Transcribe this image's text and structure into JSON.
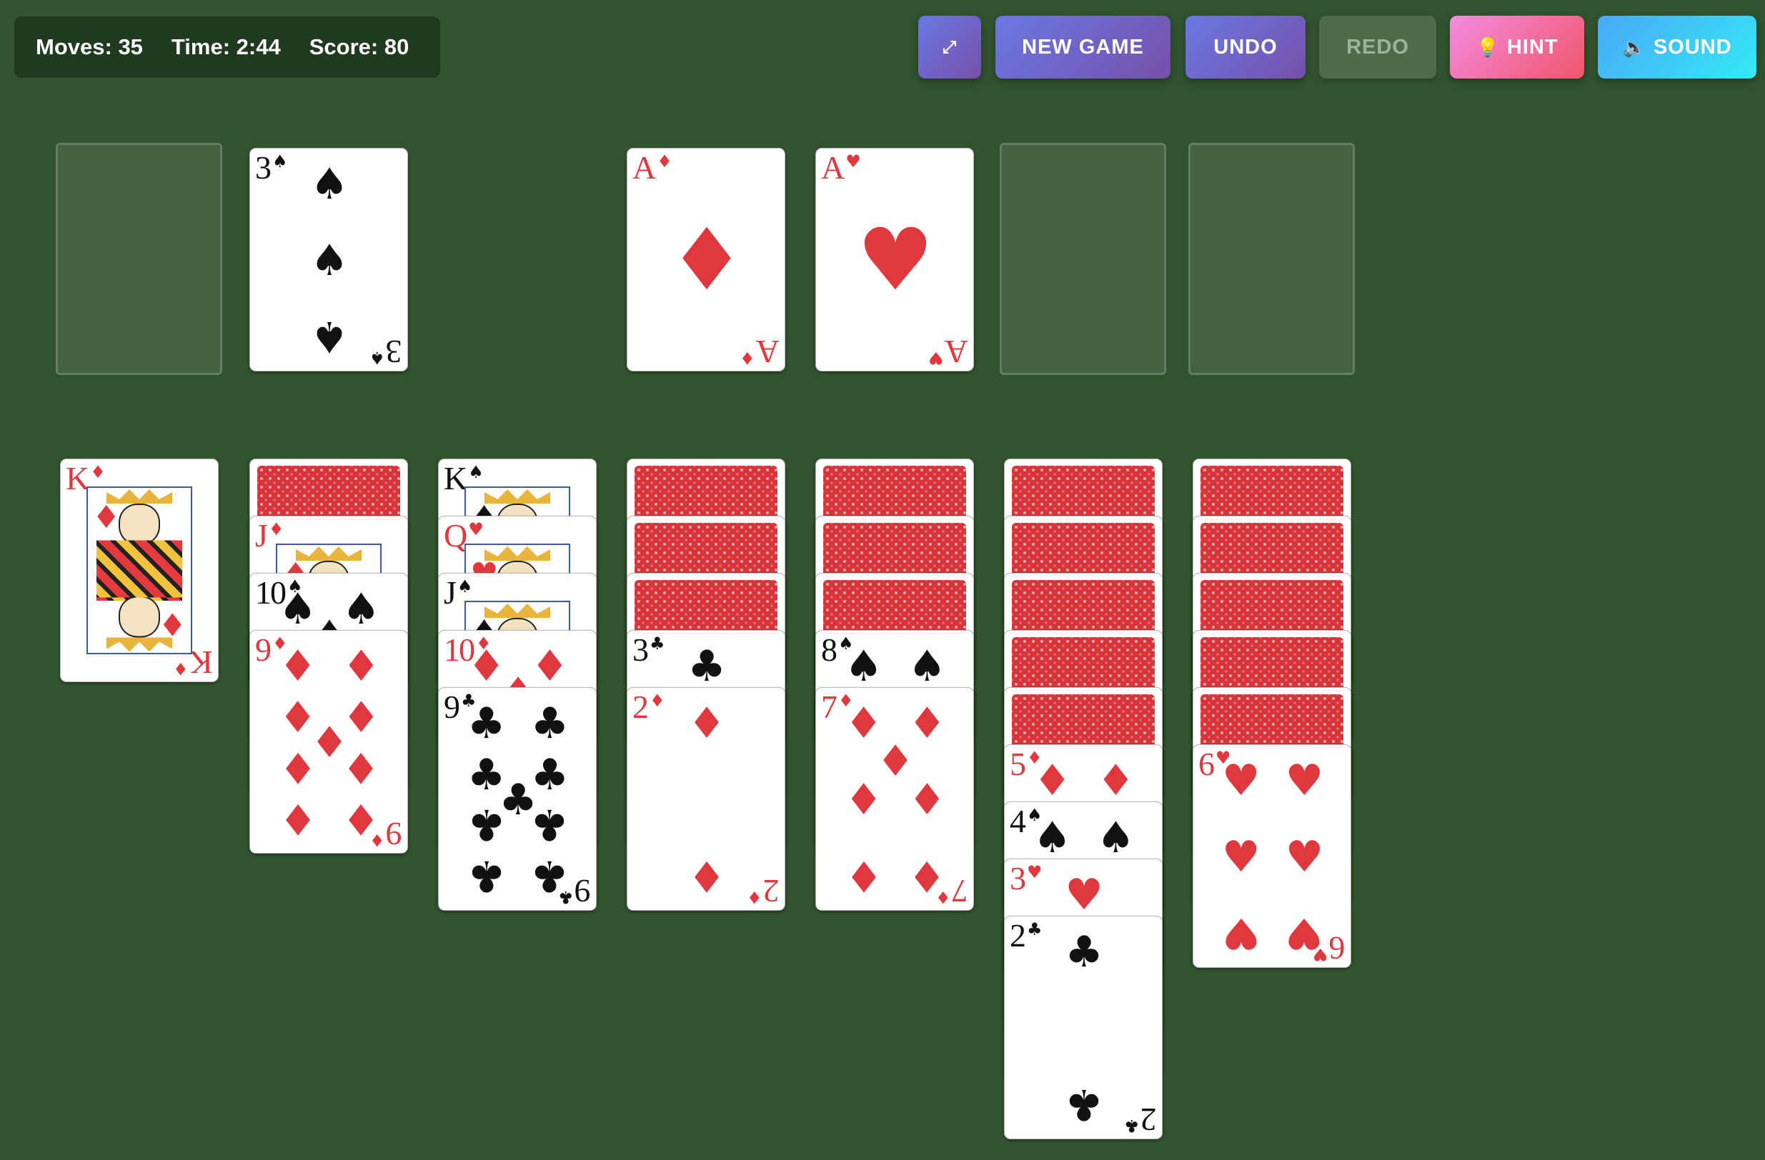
{
  "stats": {
    "moves_label": "Moves:",
    "moves_value": "35",
    "time_label": "Time:",
    "time_value": "2:44",
    "score_label": "Score:",
    "score_value": "80"
  },
  "toolbar": {
    "fullscreen_icon": "⤢",
    "new_game_label": "NEW GAME",
    "undo_label": "UNDO",
    "redo_label": "REDO",
    "hint_icon": "💡",
    "hint_label": "HINT",
    "sound_icon": "🔈",
    "sound_label": "SOUND"
  },
  "colors": {
    "table": "#32532f",
    "red_suit": "#e0383e",
    "black_suit": "#111111"
  },
  "top_row": {
    "stock": "empty",
    "waste": [
      {
        "rank": "3",
        "suit": "♠"
      }
    ],
    "foundations": [
      [
        {
          "rank": "A",
          "suit": "♦"
        }
      ],
      [
        {
          "rank": "A",
          "suit": "♥"
        }
      ],
      [],
      []
    ]
  },
  "tableau": [
    {
      "hidden": 0,
      "cards": [
        {
          "rank": "K",
          "suit": "♦"
        }
      ]
    },
    {
      "hidden": 1,
      "cards": [
        {
          "rank": "J",
          "suit": "♦"
        },
        {
          "rank": "10",
          "suit": "♠"
        },
        {
          "rank": "9",
          "suit": "♦"
        }
      ]
    },
    {
      "hidden": 0,
      "cards": [
        {
          "rank": "K",
          "suit": "♠"
        },
        {
          "rank": "Q",
          "suit": "♥"
        },
        {
          "rank": "J",
          "suit": "♠"
        },
        {
          "rank": "10",
          "suit": "♦"
        },
        {
          "rank": "9",
          "suit": "♣"
        }
      ]
    },
    {
      "hidden": 3,
      "cards": [
        {
          "rank": "3",
          "suit": "♣"
        },
        {
          "rank": "2",
          "suit": "♦"
        }
      ]
    },
    {
      "hidden": 3,
      "cards": [
        {
          "rank": "8",
          "suit": "♠"
        },
        {
          "rank": "7",
          "suit": "♦"
        }
      ]
    },
    {
      "hidden": 5,
      "cards": [
        {
          "rank": "5",
          "suit": "♦"
        },
        {
          "rank": "4",
          "suit": "♠"
        },
        {
          "rank": "3",
          "suit": "♥"
        },
        {
          "rank": "2",
          "suit": "♣"
        }
      ]
    },
    {
      "hidden": 5,
      "cards": [
        {
          "rank": "6",
          "suit": "♥"
        }
      ]
    }
  ]
}
